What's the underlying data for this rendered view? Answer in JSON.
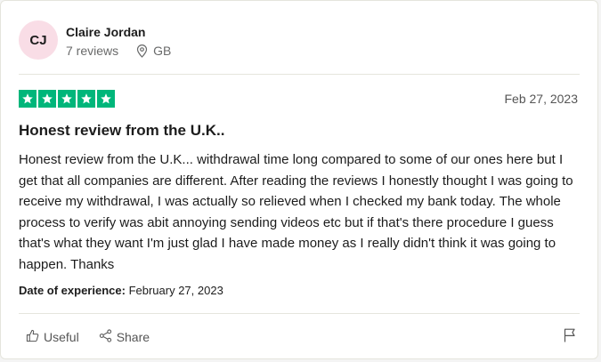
{
  "reviewer": {
    "initials": "CJ",
    "name": "Claire Jordan",
    "reviews": "7 reviews",
    "country": "GB"
  },
  "review": {
    "rating": 5,
    "date": "Feb 27, 2023",
    "title": "Honest review from the U.K..",
    "body": "Honest review from the U.K... withdrawal time long compared to some of our ones here but I get that all companies are different. After reading the reviews I honestly thought I was going to receive my withdrawal, I was actually so relieved when I checked my bank today. The whole process to verify was abit annoying sending videos etc but if that's there procedure I guess that's what they want I'm just glad I have made money as I really didn't think it was going to happen. Thanks",
    "experience_label": "Date of experience:",
    "experience_date": "February 27, 2023"
  },
  "actions": {
    "useful_label": "Useful",
    "share_label": "Share"
  },
  "colors": {
    "star": "#00b67a",
    "avatar_bg": "#f9dde6",
    "muted_text": "#696a6a"
  },
  "icons": [
    "location-pin-icon",
    "star-icon",
    "thumbs-up-icon",
    "share-icon",
    "flag-icon"
  ]
}
